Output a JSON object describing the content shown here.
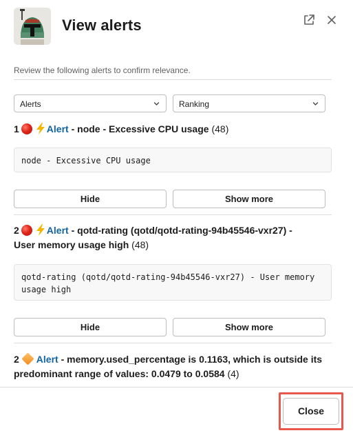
{
  "modal": {
    "title": "View alerts",
    "subtitle": "Review the following alerts to confirm relevance."
  },
  "filters": {
    "type_select": "Alerts",
    "sort_select": "Ranking"
  },
  "alerts": [
    {
      "number": "1",
      "severity_icon": "red-circle-icon",
      "link_label": "Alert",
      "text": " - node - Excessive CPU usage",
      "count": "(48)",
      "detail": "node - Excessive CPU usage",
      "hide_label": "Hide",
      "show_more_label": "Show more"
    },
    {
      "number": "2",
      "severity_icon": "red-circle-icon",
      "link_label": "Alert",
      "text_line1": " - qotd-rating (qotd/qotd-rating-94b45546-vxr27) -",
      "text_line2": "User memory usage high",
      "count": "(48)",
      "detail_line1": "qotd-rating (qotd/qotd-rating-94b45546-vxr27) - User memory",
      "detail_line2": "usage high",
      "hide_label": "Hide",
      "show_more_label": "Show more"
    },
    {
      "number": "2",
      "severity_icon": "orange-diamond-icon",
      "link_label": "Alert",
      "text_line1": " - memory.used_percentage is 0.1163, which is outside its",
      "text_line2": "predominant range of values: 0.0479 to 0.0584",
      "count": "(4)"
    }
  ],
  "footer": {
    "close_label": "Close"
  },
  "colors": {
    "link": "#1264a3",
    "highlight": "#e8574b"
  }
}
